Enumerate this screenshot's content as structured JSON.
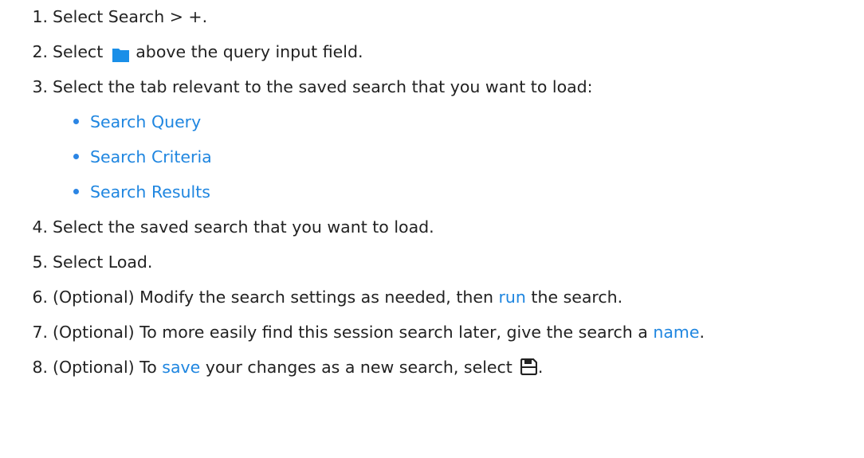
{
  "steps": [
    {
      "num": "1.",
      "text": "Select Search > +."
    },
    {
      "num": "2.",
      "pre": "Select",
      "icon": "folder-icon",
      "post": "above the query input field."
    },
    {
      "num": "3.",
      "text": "Select the tab relevant to the saved search that you want to load:"
    },
    {
      "num": "4.",
      "text": "Select the saved search that you want to load."
    },
    {
      "num": "5.",
      "text": "Select Load."
    },
    {
      "num": "6.",
      "pre": "(Optional) Modify the search settings as needed, then ",
      "link": "run",
      "post": " the search."
    },
    {
      "num": "7.",
      "pre": "(Optional) To more easily find this session search later, give the search a ",
      "link": "name",
      "post": "."
    },
    {
      "num": "8.",
      "pre": "(Optional) To ",
      "link": "save",
      "mid": " your changes as a new search, select",
      "icon": "save-icon",
      "post": "."
    }
  ],
  "tab_links": [
    "Search Query",
    "Search Criteria",
    "Search Results"
  ],
  "colors": {
    "link": "#1f86e0",
    "text": "#222222",
    "folder": "#1a8fe8",
    "bullet": "#2b85e4"
  }
}
